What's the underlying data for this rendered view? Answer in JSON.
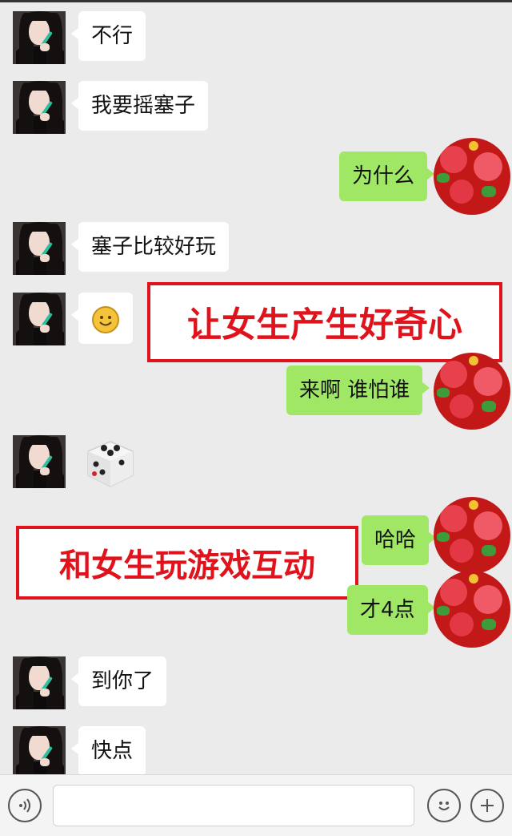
{
  "messages": [
    {
      "side": "left",
      "text": "不行"
    },
    {
      "side": "left",
      "text": "我要摇塞子"
    },
    {
      "side": "right",
      "text": "为什么"
    },
    {
      "side": "left",
      "text": "塞子比较好玩"
    },
    {
      "side": "left",
      "emoji": "smile-emoji"
    },
    {
      "side": "right",
      "text": "来啊 谁怕谁"
    },
    {
      "side": "left",
      "sticker": "dice-sticker"
    },
    {
      "side": "right",
      "text": "哈哈"
    },
    {
      "side": "right",
      "text": "才4点"
    },
    {
      "side": "left",
      "text": "到你了"
    },
    {
      "side": "left",
      "text": "快点"
    }
  ],
  "annotations": {
    "curiosity": "让女生产生好奇心",
    "game": "和女生玩游戏互动"
  },
  "colors": {
    "background": "#ebebeb",
    "my_bubble": "#9fe765",
    "their_bubble": "#ffffff",
    "annotation_red": "#e0121c"
  },
  "input_bar": {
    "voice_icon": "voice-icon",
    "emoji_icon": "emoji-icon",
    "plus_icon": "plus-icon",
    "text_value": ""
  }
}
